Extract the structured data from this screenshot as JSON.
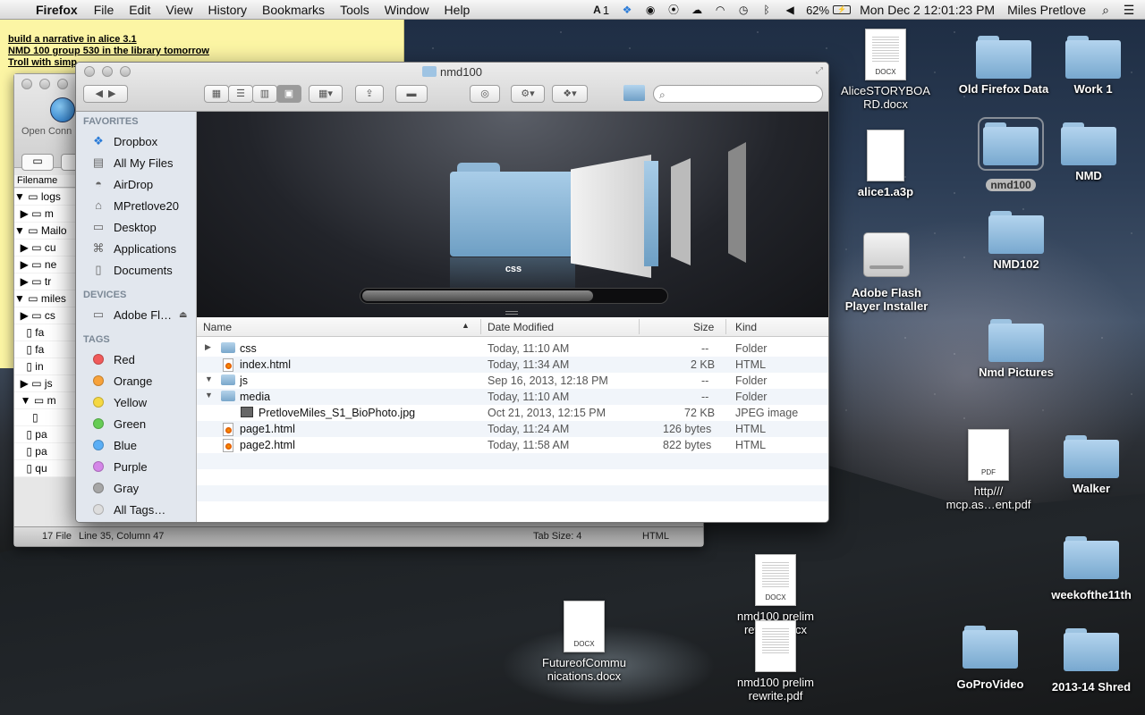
{
  "menubar": {
    "app_name": "Firefox",
    "menus": [
      "File",
      "Edit",
      "View",
      "History",
      "Bookmarks",
      "Tools",
      "Window",
      "Help"
    ],
    "status": {
      "adobe_count": "1",
      "battery": "62%",
      "datetime": "Mon Dec 2  12:01:23 PM",
      "user": "Miles Pretlove"
    }
  },
  "sticky": {
    "lines": [
      "build a narrative in alice 3.1",
      "NMD 100 group 530 in the library tomorrow",
      "Troll with simp"
    ]
  },
  "editor": {
    "open_label": "Open Conn",
    "file_header": "Filename",
    "tree": [
      "logs",
      "m",
      "Mailo",
      "cu",
      "ne",
      "tr",
      "miles",
      "cs",
      "fa",
      "fa",
      "in",
      "js",
      "m",
      "",
      "pa",
      "pa",
      "qu"
    ],
    "status": {
      "files": "17 File",
      "position": "Line 35, Column 47",
      "tab_size": "Tab Size: 4",
      "syntax": "HTML"
    }
  },
  "finder": {
    "title": "nmd100",
    "search_placeholder": "",
    "sidebar": {
      "favorites_header": "FAVORITES",
      "favorites": [
        {
          "label": "Dropbox",
          "icon": "dropbox-icon"
        },
        {
          "label": "All My Files",
          "icon": "all-files-icon"
        },
        {
          "label": "AirDrop",
          "icon": "airdrop-icon"
        },
        {
          "label": "MPretlove20",
          "icon": "home-icon"
        },
        {
          "label": "Desktop",
          "icon": "desktop-icon"
        },
        {
          "label": "Applications",
          "icon": "applications-icon"
        },
        {
          "label": "Documents",
          "icon": "documents-icon"
        }
      ],
      "devices_header": "DEVICES",
      "devices": [
        {
          "label": "Adobe Fl…",
          "icon": "drive-icon"
        }
      ],
      "tags_header": "TAGS",
      "tags": [
        {
          "label": "Red",
          "color": "#f05a5a"
        },
        {
          "label": "Orange",
          "color": "#f7a23a"
        },
        {
          "label": "Yellow",
          "color": "#f5d842"
        },
        {
          "label": "Green",
          "color": "#66cc55"
        },
        {
          "label": "Blue",
          "color": "#5aaef5"
        },
        {
          "label": "Purple",
          "color": "#d486e8"
        },
        {
          "label": "Gray",
          "color": "#a6a6a6"
        },
        {
          "label": "All Tags…",
          "color": "#dddddd"
        }
      ]
    },
    "coverflow_caption": "css",
    "columns": {
      "name": "Name",
      "date": "Date Modified",
      "size": "Size",
      "kind": "Kind"
    },
    "files": [
      {
        "name": "css",
        "date": "Today, 11:10 AM",
        "size": "--",
        "kind": "Folder",
        "type": "folder",
        "disclosure": "closed",
        "indent": 0
      },
      {
        "name": "index.html",
        "date": "Today, 11:34 AM",
        "size": "2 KB",
        "kind": "HTML",
        "type": "html",
        "disclosure": "",
        "indent": 0
      },
      {
        "name": "js",
        "date": "Sep 16, 2013, 12:18 PM",
        "size": "--",
        "kind": "Folder",
        "type": "folder",
        "disclosure": "open",
        "indent": 0
      },
      {
        "name": "media",
        "date": "Today, 11:10 AM",
        "size": "--",
        "kind": "Folder",
        "type": "folder",
        "disclosure": "open",
        "indent": 0
      },
      {
        "name": "PretloveMiles_S1_BioPhoto.jpg",
        "date": "Oct 21, 2013, 12:15 PM",
        "size": "72 KB",
        "kind": "JPEG image",
        "type": "image",
        "disclosure": "",
        "indent": 1
      },
      {
        "name": "page1.html",
        "date": "Today, 11:24 AM",
        "size": "126 bytes",
        "kind": "HTML",
        "type": "html",
        "disclosure": "",
        "indent": 0
      },
      {
        "name": "page2.html",
        "date": "Today, 11:58 AM",
        "size": "822 bytes",
        "kind": "HTML",
        "type": "html",
        "disclosure": "",
        "indent": 0
      }
    ]
  },
  "desktop": {
    "items": [
      {
        "label": "AliceSTORYBOARD.docx",
        "label_lines": [
          "AliceSTORYBOA",
          "RD.docx"
        ],
        "type": "docx",
        "badge": "DOCX"
      },
      {
        "label": "Old Firefox Data",
        "type": "folder"
      },
      {
        "label": "Work 1",
        "type": "folder"
      },
      {
        "label": "alice1.a3p",
        "type": "doc"
      },
      {
        "label": "nmd100",
        "type": "folder",
        "selected": true
      },
      {
        "label": "NMD",
        "type": "folder"
      },
      {
        "label": "NMD102",
        "type": "folder"
      },
      {
        "label": "Adobe Flash Player Installer",
        "label_lines": [
          "Adobe Flash",
          "Player Installer"
        ],
        "type": "drive"
      },
      {
        "label": "Nmd Pictures",
        "type": "folder"
      },
      {
        "label": "http///mcp.as…ent.pdf",
        "label_lines": [
          "http///",
          "mcp.as…ent.pdf"
        ],
        "type": "pdf",
        "badge": "PDF"
      },
      {
        "label": "Walker",
        "type": "folder"
      },
      {
        "label": "weekofthe11th",
        "type": "folder"
      },
      {
        "label": "nmd100 prelim rewrite.docx",
        "label_lines": [
          "nmd100 prelim",
          "rewrite.docx"
        ],
        "type": "docx",
        "badge": "DOCX"
      },
      {
        "label": "FutureofCommunications.docx",
        "label_lines": [
          "FutureofCommu",
          "nications.docx"
        ],
        "type": "docx",
        "badge": "DOCX"
      },
      {
        "label": "nmd100 prelim rewrite.pdf",
        "label_lines": [
          "nmd100 prelim",
          "rewrite.pdf"
        ],
        "type": "pdf"
      },
      {
        "label": "GoProVideo",
        "type": "folder"
      },
      {
        "label": "2013-14 Shred",
        "type": "folder"
      }
    ]
  }
}
